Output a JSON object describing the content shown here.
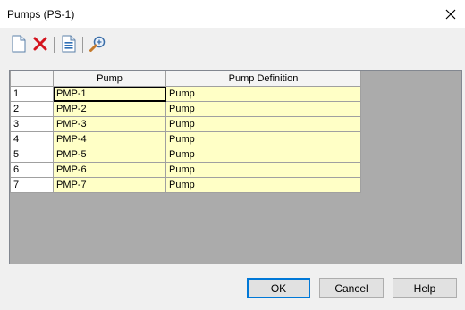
{
  "window": {
    "title": "Pumps (PS-1)",
    "close_glyph": "✕"
  },
  "toolbar": {
    "buttons": [
      {
        "name": "new-icon"
      },
      {
        "name": "delete-icon"
      },
      {
        "name": "report-icon"
      },
      {
        "name": "zoom-icon"
      }
    ]
  },
  "table": {
    "columns": [
      "Pump",
      "Pump Definition"
    ],
    "rows": [
      {
        "num": "1",
        "pump": "PMP-1",
        "definition": "Pump"
      },
      {
        "num": "2",
        "pump": "PMP-2",
        "definition": "Pump"
      },
      {
        "num": "3",
        "pump": "PMP-3",
        "definition": "Pump"
      },
      {
        "num": "4",
        "pump": "PMP-4",
        "definition": "Pump"
      },
      {
        "num": "5",
        "pump": "PMP-5",
        "definition": "Pump"
      },
      {
        "num": "6",
        "pump": "PMP-6",
        "definition": "Pump"
      },
      {
        "num": "7",
        "pump": "PMP-7",
        "definition": "Pump"
      }
    ],
    "selected_row": 0,
    "colors": {
      "cell_bg": "#ffffc6",
      "grid_bg": "#ababab"
    }
  },
  "footer": {
    "ok_label": "OK",
    "cancel_label": "Cancel",
    "help_label": "Help"
  }
}
